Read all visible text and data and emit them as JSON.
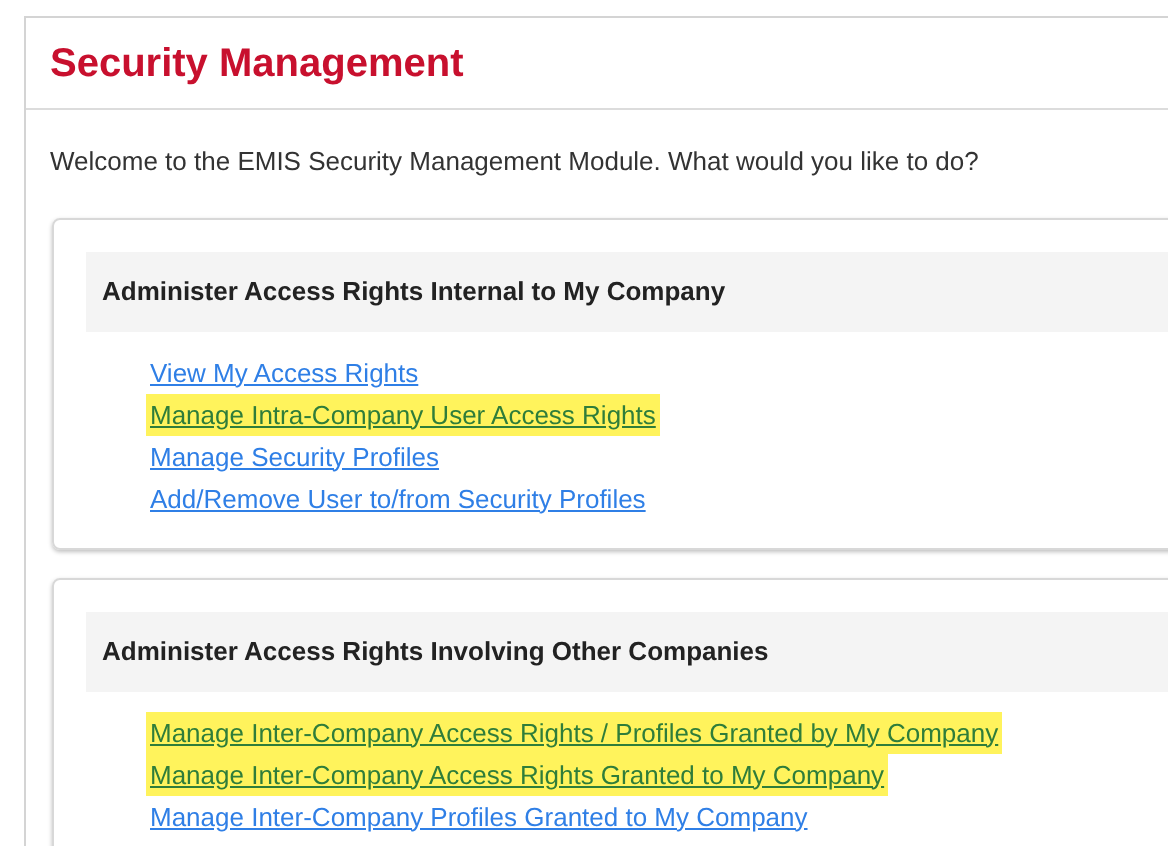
{
  "title": "Security Management",
  "intro": "Welcome to the EMIS Security Management Module. What would you like to do?",
  "sections": [
    {
      "heading": "Administer Access Rights Internal to My Company",
      "links": [
        {
          "label": "View My Access Rights",
          "highlighted": false
        },
        {
          "label": "Manage Intra-Company User Access Rights",
          "highlighted": true
        },
        {
          "label": "Manage Security Profiles",
          "highlighted": false
        },
        {
          "label": "Add/Remove User to/from Security Profiles",
          "highlighted": false
        }
      ]
    },
    {
      "heading": "Administer Access Rights Involving Other Companies",
      "links": [
        {
          "label": "Manage Inter-Company Access Rights / Profiles Granted by My Company",
          "highlighted": true
        },
        {
          "label": "Manage Inter-Company Access Rights Granted to My Company",
          "highlighted": true
        },
        {
          "label": "Manage Inter-Company Profiles Granted to My Company",
          "highlighted": false
        }
      ]
    }
  ]
}
